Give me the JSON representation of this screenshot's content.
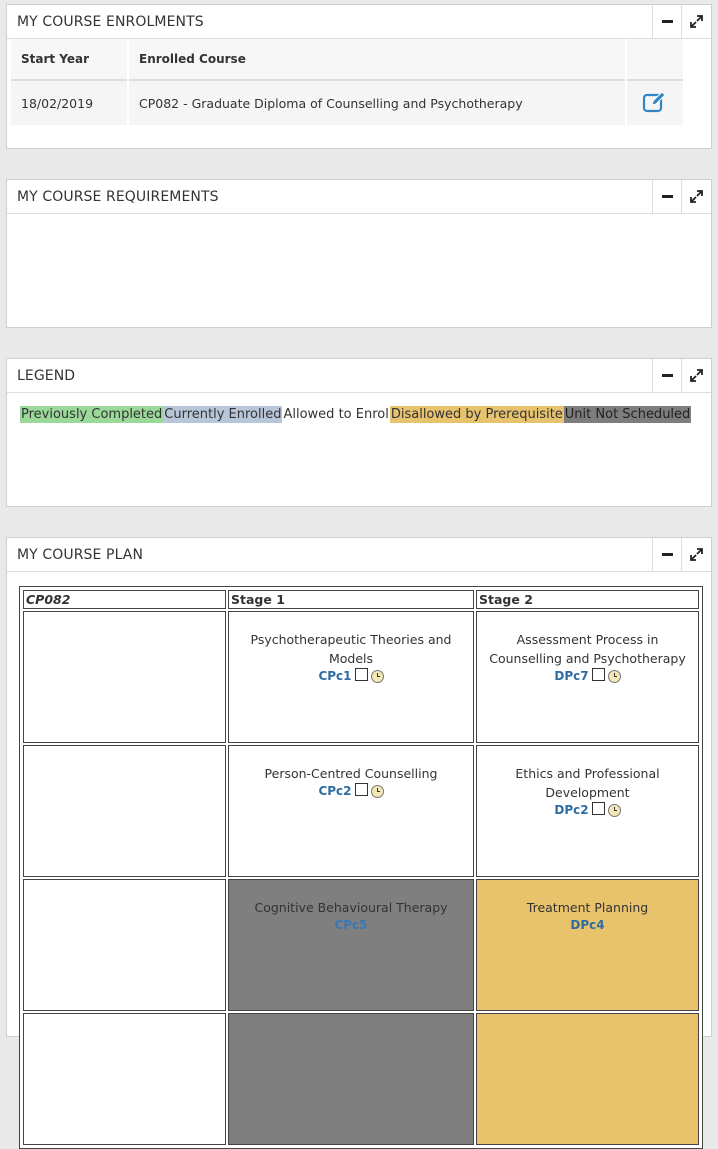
{
  "enrolments": {
    "title": "MY COURSE ENROLMENTS",
    "headers": [
      "Start Year",
      "Enrolled Course",
      ""
    ],
    "rows": [
      {
        "start": "18/02/2019",
        "course": "CP082 - Graduate Diploma of Counselling and Psychotherapy"
      }
    ]
  },
  "requirements": {
    "title": "MY COURSE REQUIREMENTS"
  },
  "legend": {
    "title": "LEGEND",
    "items": [
      "Previously Completed",
      "Currently Enrolled",
      "Allowed to Enrol",
      "Disallowed by Prerequisite",
      "Unit Not Scheduled"
    ],
    "colors": {
      "completed": "#9ad99a",
      "enrolled": "#b8c6da",
      "disallowed": "#e7c36e",
      "not_scheduled": "#7d7d7d"
    }
  },
  "plan": {
    "title": "MY COURSE PLAN",
    "headers": [
      "CP082",
      "Stage 1",
      "Stage 2"
    ],
    "rows": [
      [
        {
          "name": "Psychotherapeutic Theories and Models",
          "code": "CPc1"
        },
        {
          "name": "Assessment Process in Counselling and Psychotherapy",
          "code": "DPc7"
        }
      ],
      [
        {
          "name": "Person-Centred Counselling",
          "code": "CPc2"
        },
        {
          "name": "Ethics and Professional Development",
          "code": "DPc2"
        }
      ],
      [
        {
          "name": "Cognitive Behavioural Therapy",
          "code": "CPc5"
        },
        {
          "name": "Treatment Planning",
          "code": "DPc4"
        }
      ]
    ]
  }
}
